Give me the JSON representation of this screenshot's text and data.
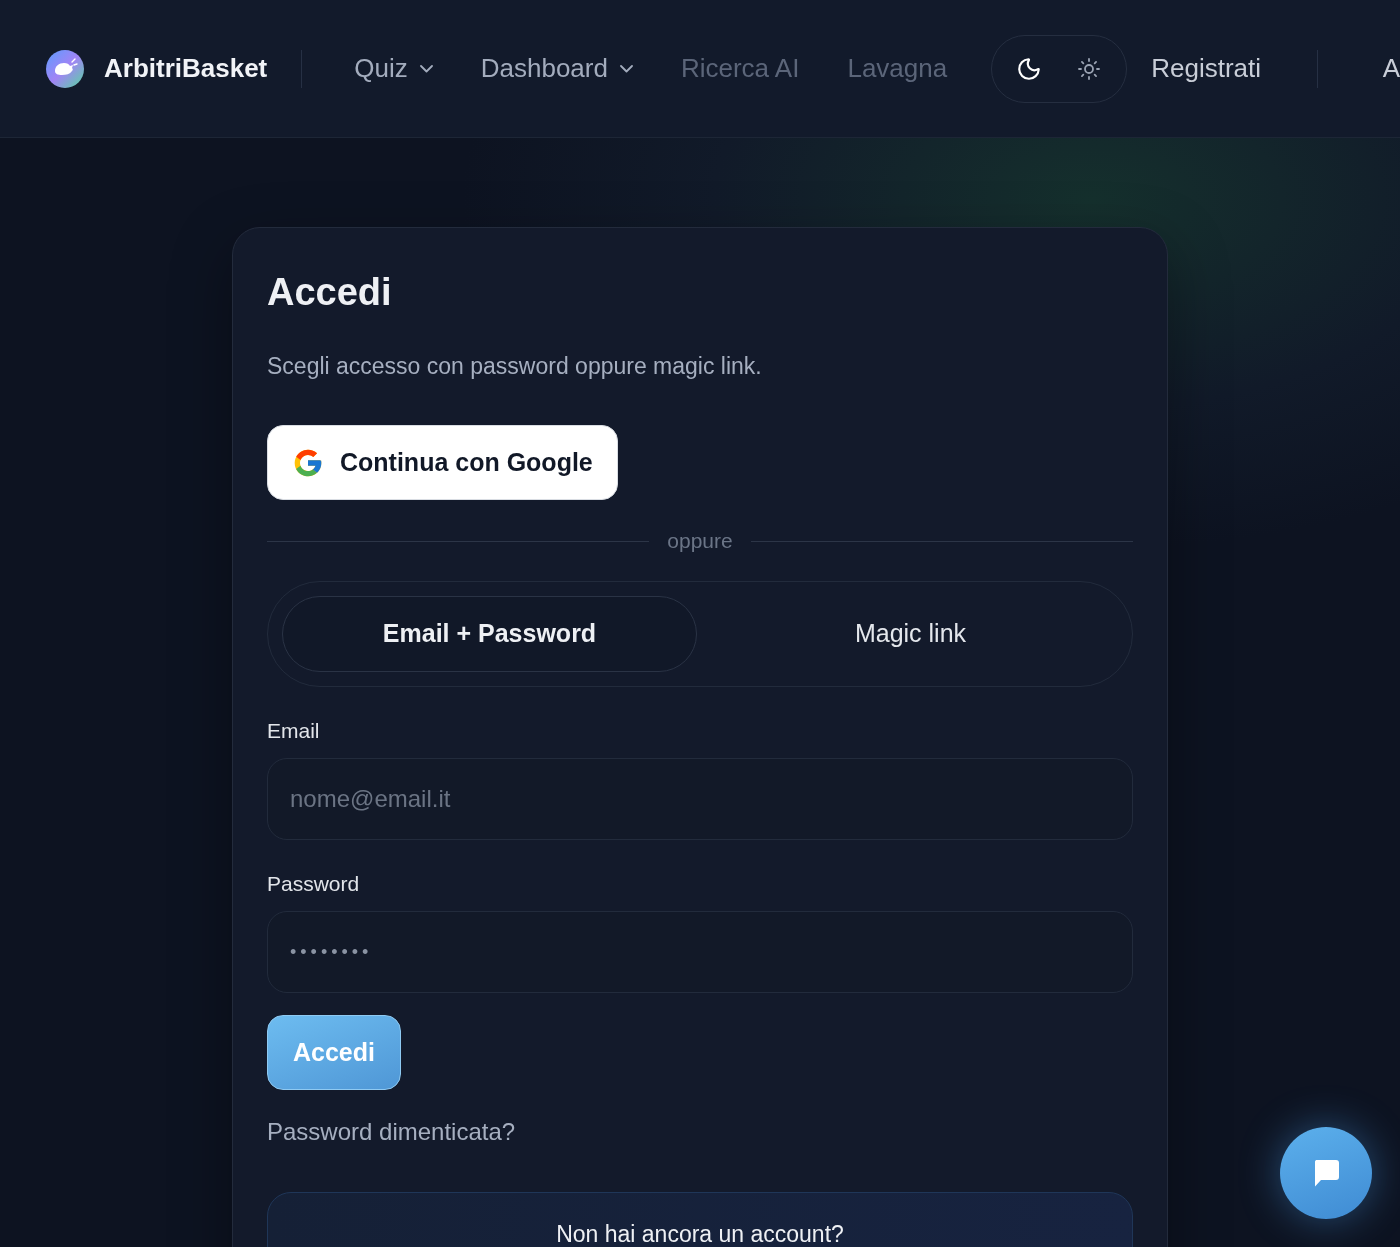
{
  "header": {
    "brand": "ArbitriBasket",
    "nav": [
      {
        "label": "Quiz",
        "kind": "menu",
        "disabled": false
      },
      {
        "label": "Dashboard",
        "kind": "menu",
        "disabled": false
      },
      {
        "label": "Ricerca AI",
        "kind": "link",
        "disabled": true
      },
      {
        "label": "Lavagna",
        "kind": "link",
        "disabled": true
      }
    ],
    "theme_toggle": [
      {
        "kind": "dark",
        "selected": true
      },
      {
        "kind": "light",
        "selected": false
      }
    ],
    "register_link": "Registrati",
    "cut_off_item": "A"
  },
  "login_card": {
    "title": "Accedi",
    "subtitle": "Scegli accesso con password oppure magic link.",
    "google_button": "Continua con Google",
    "separator": "oppure",
    "tabs": [
      {
        "label": "Email + Password",
        "selected": true
      },
      {
        "label": "Magic link",
        "selected": false
      }
    ],
    "fields": [
      {
        "kind": "email",
        "label": "Email",
        "placeholder": "nome@email.it"
      },
      {
        "kind": "password",
        "label": "Password",
        "value": "••••••••"
      }
    ],
    "submit_button": "Accedi",
    "forgot_link": "Password dimenticata?",
    "signup_box": {
      "text": "Non hai ancora un account?"
    }
  }
}
